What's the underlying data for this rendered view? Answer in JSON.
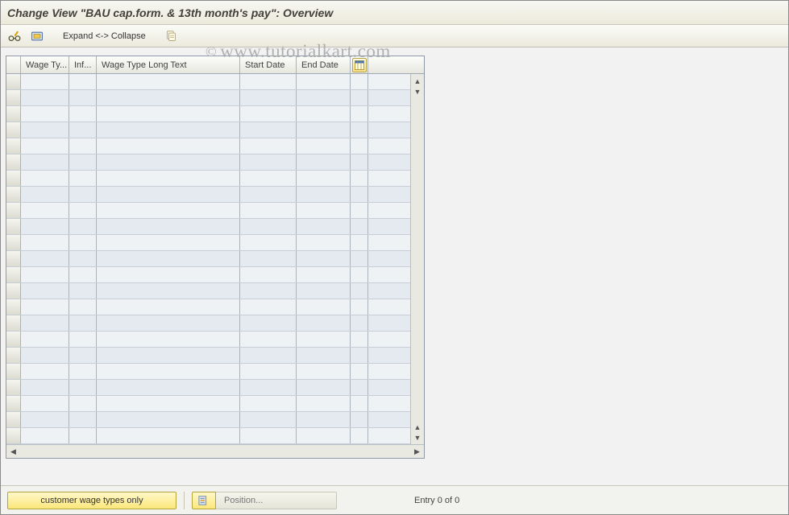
{
  "title": "Change View \"BAU cap.form. & 13th month's pay\": Overview",
  "toolbar": {
    "expand_collapse_label": "Expand <-> Collapse"
  },
  "watermark": "www.tutorialkart.com",
  "table": {
    "columns": {
      "wage_type": "Wage Ty...",
      "inf": "Inf...",
      "long_text": "Wage Type Long Text",
      "start_date": "Start Date",
      "end_date": "End Date"
    },
    "row_count": 23
  },
  "footer": {
    "customer_btn": "customer wage types only",
    "position_btn": "Position...",
    "entry_text": "Entry 0 of 0"
  }
}
